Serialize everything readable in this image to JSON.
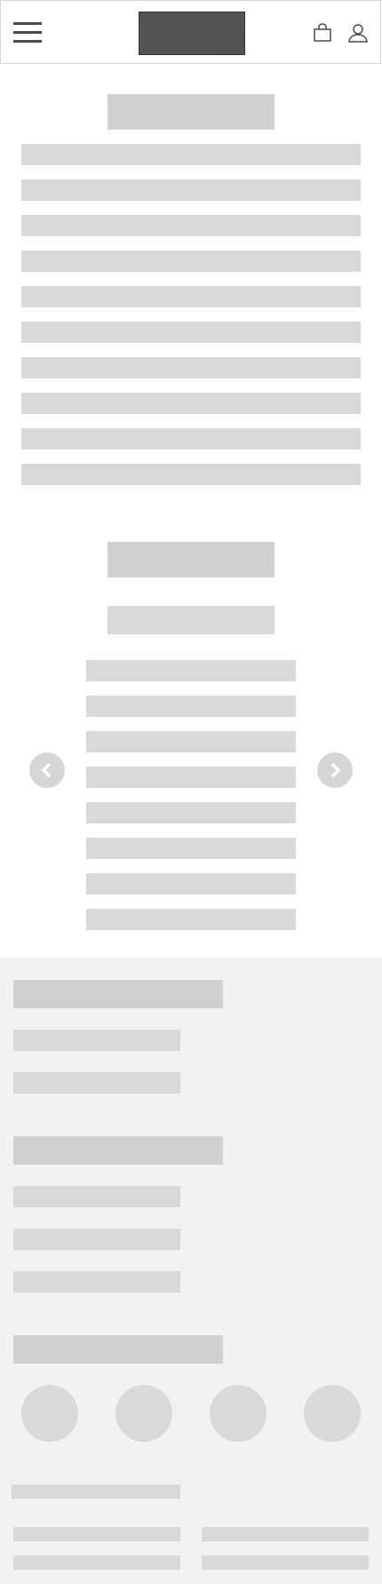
{
  "header": {
    "menu_icon": "hamburger-icon",
    "logo": "logo-placeholder",
    "cart_icon": "shopping-bag-icon",
    "account_icon": "user-icon"
  },
  "content_section": {
    "title_placeholder_count": 1,
    "text_line_count": 10
  },
  "carousel": {
    "title_placeholder_count": 2,
    "text_line_count": 8,
    "prev_icon": "chevron-left-icon",
    "next_icon": "chevron-right-icon"
  },
  "footer": {
    "groups": [
      {
        "heading_placeholder": true,
        "link_count": 2
      },
      {
        "heading_placeholder": true,
        "link_count": 3
      },
      {
        "heading_placeholder": true,
        "social_icon_count": 4
      }
    ],
    "bottom_lines": {
      "left_count": 3,
      "right_count": 2
    }
  },
  "colors": {
    "header_border": "#d6d6d6",
    "placeholder_dark": "#d0d0d0",
    "placeholder_light": "#d9d9d9",
    "footer_bg": "#f2f2f2",
    "icon": "#4a4a4a"
  }
}
